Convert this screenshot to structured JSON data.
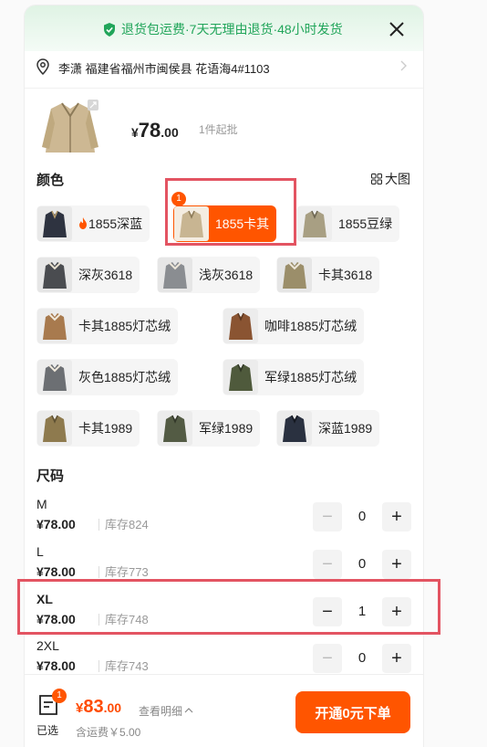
{
  "banner": {
    "text": "退货包运费·7天无理由退货·48小时发货"
  },
  "address": {
    "text": "李潇 福建省福州市闽侯县 花语海4#1103"
  },
  "product": {
    "price_currency": "¥",
    "price_int": "78",
    "price_dec": ".00",
    "moq": "1件起批"
  },
  "color_section": {
    "title": "颜色",
    "bigpic_label": "大图"
  },
  "colors": [
    {
      "label": "1855深蓝",
      "hot": true,
      "selected": false,
      "swatch": "#2e3340"
    },
    {
      "label": "1855卡其",
      "selected": true,
      "badge": "1",
      "swatch": "#c8b592"
    },
    {
      "label": "1855豆绿",
      "selected": false,
      "swatch": "#a89f83"
    },
    {
      "label": "深灰3618",
      "selected": false,
      "swatch": "#4a4c50"
    },
    {
      "label": "浅灰3618",
      "selected": false,
      "swatch": "#8a8d91"
    },
    {
      "label": "卡其3618",
      "selected": false,
      "swatch": "#9b8e6a"
    },
    {
      "label": "卡其1885灯芯绒",
      "selected": false,
      "swatch": "#a87a4e"
    },
    {
      "label": "咖啡1885灯芯绒",
      "selected": false,
      "swatch": "#8a5432"
    },
    {
      "label": "灰色1885灯芯绒",
      "selected": false,
      "swatch": "#6c6f73"
    },
    {
      "label": "军绿1885灯芯绒",
      "selected": false,
      "swatch": "#4f5a3c"
    },
    {
      "label": "卡其1989",
      "selected": false,
      "swatch": "#8e7a4e"
    },
    {
      "label": "军绿1989",
      "selected": false,
      "swatch": "#535b44"
    },
    {
      "label": "深蓝1989",
      "selected": false,
      "swatch": "#2a3140"
    }
  ],
  "size_section": {
    "title": "尺码"
  },
  "sizes": [
    {
      "name": "M",
      "price": "¥78.00",
      "stock": "库存824",
      "qty": "0"
    },
    {
      "name": "L",
      "price": "¥78.00",
      "stock": "库存773",
      "qty": "0"
    },
    {
      "name": "XL",
      "price": "¥78.00",
      "stock": "库存748",
      "qty": "1"
    },
    {
      "name": "2XL",
      "price": "¥78.00",
      "stock": "库存743",
      "qty": "0"
    }
  ],
  "footer": {
    "cart_badge": "1",
    "cart_label": "已选",
    "total_currency": "¥",
    "total_int": "83",
    "total_dec": ".00",
    "detail_label": "查看明细",
    "shipping_note": "含运费￥5.00",
    "cta_label": "开通0元下单"
  },
  "colors_theme": {
    "accent": "#ff5500",
    "banner_green": "#21a55a",
    "highlight": "#e35462"
  }
}
